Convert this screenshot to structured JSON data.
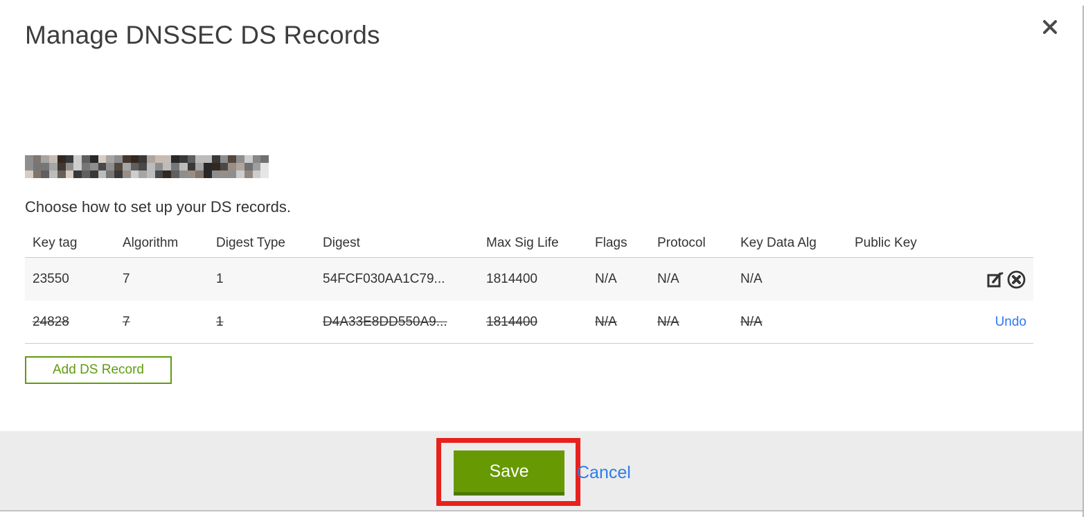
{
  "modal": {
    "title": "Manage DNSSEC DS Records",
    "close_icon": "x-close",
    "domain": {
      "redacted": true
    },
    "instruction": "Choose how to set up your DS records.",
    "table": {
      "columns": [
        "Key tag",
        "Algorithm",
        "Digest Type",
        "Digest",
        "Max Sig Life",
        "Flags",
        "Protocol",
        "Key Data Alg",
        "Public Key"
      ],
      "rows": [
        {
          "key_tag": "23550",
          "algorithm": "7",
          "digest_type": "1",
          "digest": "54FCF030AA1C79...",
          "max_sig_life": "1814400",
          "flags": "N/A",
          "protocol": "N/A",
          "key_data_alg": "N/A",
          "public_key": "",
          "state": "normal",
          "actions": [
            "edit",
            "delete"
          ]
        },
        {
          "key_tag": "24828",
          "algorithm": "7",
          "digest_type": "1",
          "digest": "D4A33E8DD550A9...",
          "max_sig_life": "1814400",
          "flags": "N/A",
          "protocol": "N/A",
          "key_data_alg": "N/A",
          "public_key": "",
          "state": "deleted",
          "undo_label": "Undo"
        }
      ]
    },
    "add_button_label": "Add DS Record",
    "footer": {
      "save_label": "Save",
      "cancel_label": "Cancel"
    },
    "annotation": {
      "shape": "red-rectangle",
      "target": "save-button"
    }
  },
  "colors": {
    "accent-green": "#669902",
    "accent-green-dark": "#4c7a04",
    "outline-green": "#619a0f",
    "link-blue": "#2e7ce8",
    "annotation-red": "#e8211d"
  }
}
